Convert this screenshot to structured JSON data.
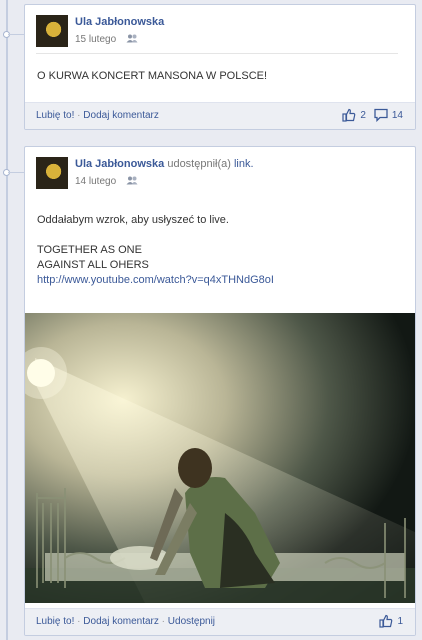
{
  "posts": [
    {
      "author": "Ula Jabłonowska",
      "action": "",
      "link_word": "",
      "date": "15 lutego",
      "lines": [
        "O KURWA KONCERT MANSONA W POLSCE!"
      ],
      "url": "",
      "actions": {
        "like": "Lubię to!",
        "comment": "Dodaj komentarz",
        "share": ""
      },
      "stats": {
        "likes": "2",
        "comments": "14"
      }
    },
    {
      "author": "Ula Jabłonowska",
      "action": "udostępnił(a)",
      "link_word": "link.",
      "date": "14 lutego",
      "lines": [
        "Oddałabym wzrok, aby usłyszeć to live.",
        "",
        "TOGETHER AS ONE",
        "AGAINST ALL OHERS"
      ],
      "url": "http://www.youtube.com/watch?v=q4xTHNdG8oI",
      "actions": {
        "like": "Lubię to!",
        "comment": "Dodaj komentarz",
        "share": "Udostępnij"
      },
      "stats": {
        "likes": "1",
        "comments": ""
      }
    }
  ],
  "separator": "·",
  "colors": {
    "link": "#3b5998",
    "page_bg": "#e9ebf2",
    "footer_bg": "#edeff4"
  },
  "icons": {
    "audience": "friends-icon",
    "like": "thumbs-up-icon",
    "comment": "comment-bubble-icon"
  }
}
